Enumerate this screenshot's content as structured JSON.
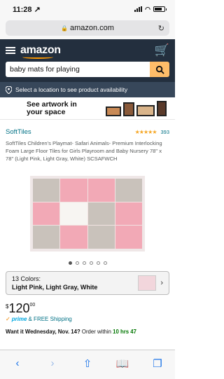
{
  "status": {
    "time": "11:28",
    "time_arrow": "↗"
  },
  "browser": {
    "url": "amazon.com"
  },
  "header": {
    "logo": "amazon",
    "search_value": "baby mats for playing"
  },
  "location": {
    "label": "Select a location to see product availability"
  },
  "banner": {
    "line1": "See artwork in",
    "line2": "your space"
  },
  "product": {
    "brand": "SoftTiles",
    "stars": "★★★★★",
    "review_count": "393",
    "title": "SoftTiles Children's Playmat- Safari Animals- Premium Interlocking Foam Large Floor Tiles for Girls Playroom and Baby Nursery 78\" x 78\" (Light Pink, Light Gray, White) SCSAFWCH",
    "tiles": [
      "🐘",
      "🦒",
      "🐈",
      "🐻",
      "🦒",
      "🦏",
      "🐘",
      "🦛",
      "🦁",
      "🐘",
      "🦒",
      "🐻"
    ],
    "tile_colors": [
      "gray",
      "pink",
      "pink",
      "gray",
      "pink",
      "white",
      "gray",
      "pink",
      "gray",
      "pink",
      "gray",
      "pink"
    ],
    "image_dots": 6,
    "colors_count": "13 Colors:",
    "colors_value": "Light Pink, Light Gray, White",
    "price_currency": "$",
    "price_whole": "120",
    "price_fraction": "00",
    "prime_check": "✓",
    "prime_label": "prime",
    "shipping": "& FREE Shipping",
    "delivery_prefix": "Want it Wednesday, Nov. 14?",
    "delivery_middle": " Order within ",
    "delivery_time": "10 hrs 47"
  },
  "toolbar": {
    "back": "‹",
    "forward": "›",
    "share": "⇧",
    "bookmarks": "📖",
    "tabs": "❐"
  }
}
